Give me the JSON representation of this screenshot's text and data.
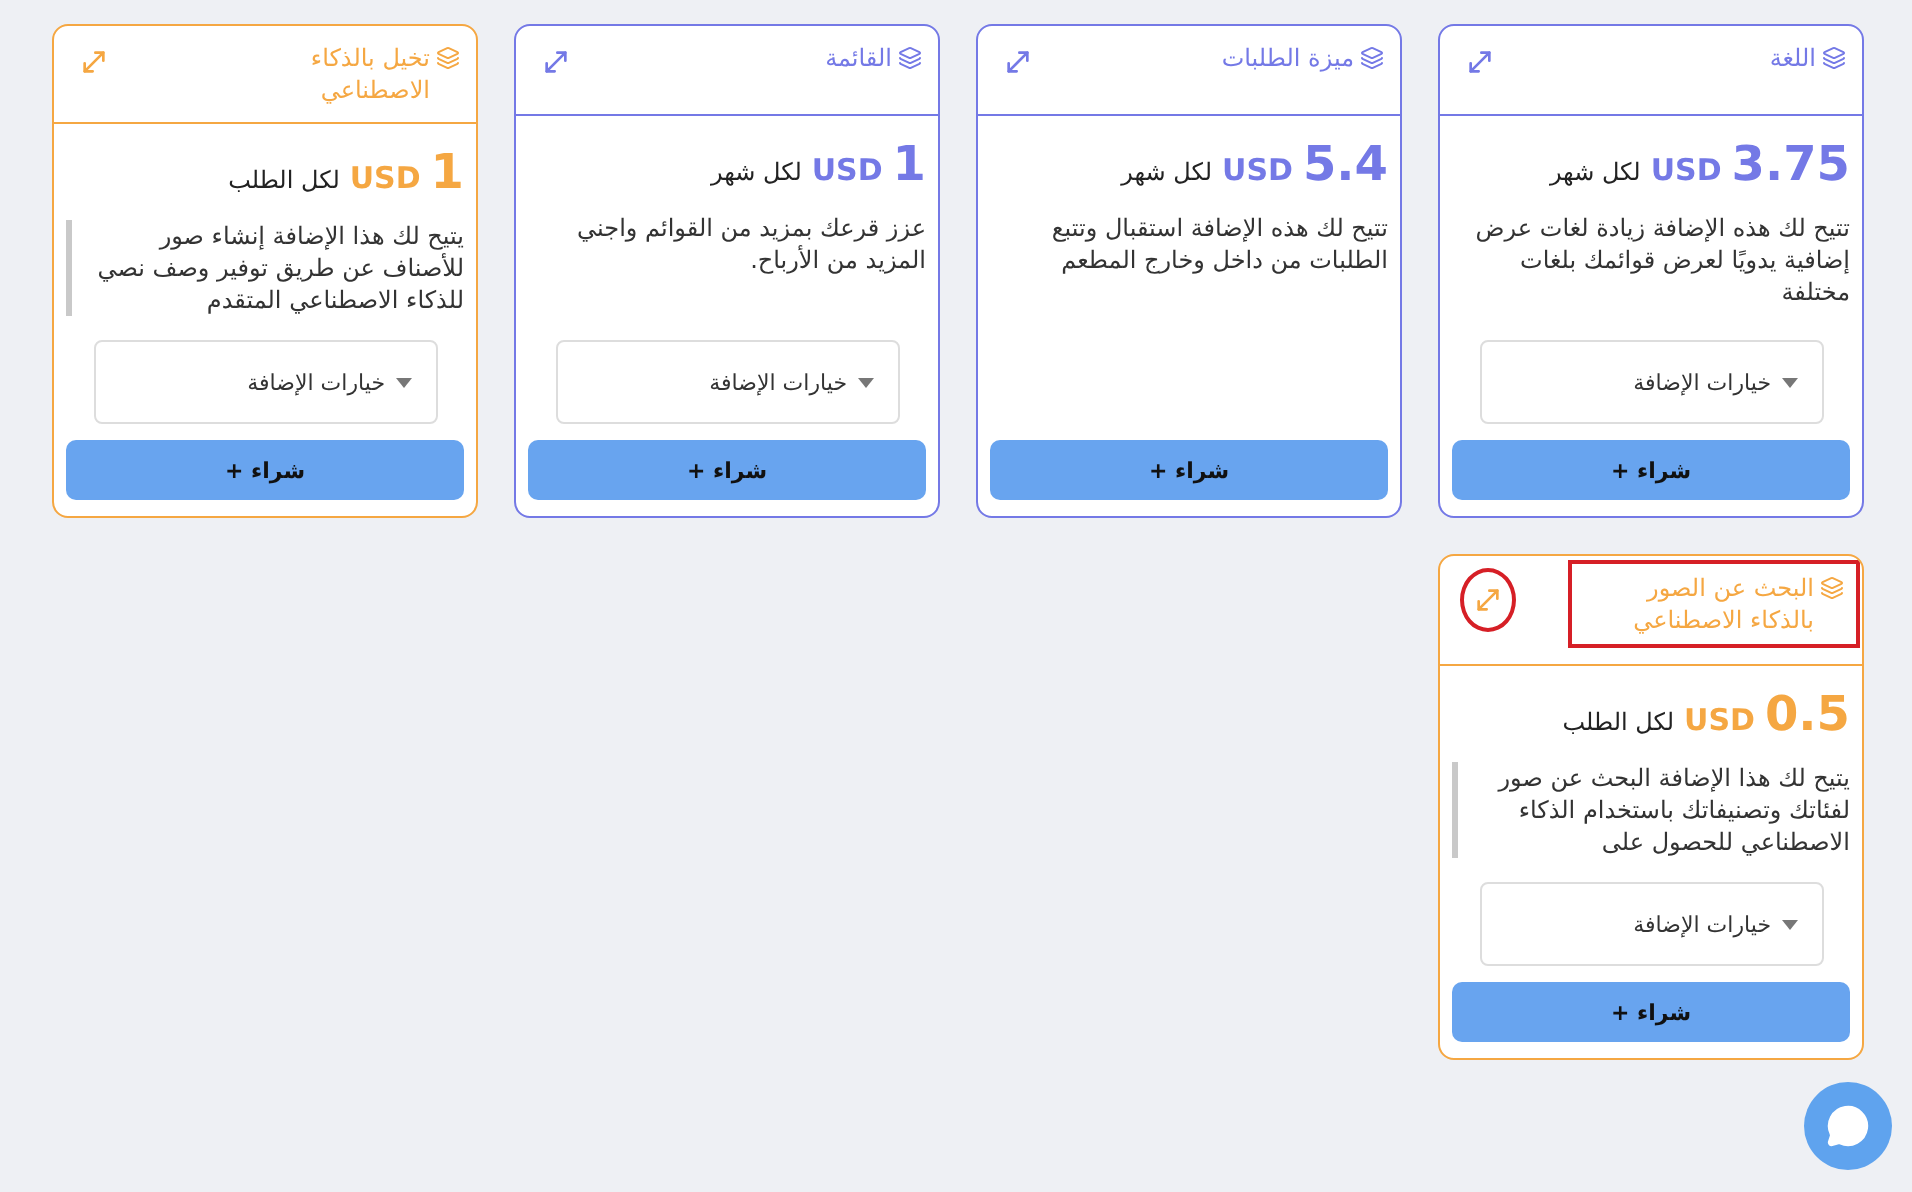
{
  "cards": [
    {
      "title": "اللغة",
      "color": "#7479e6",
      "annotated": false,
      "amount": "3.75",
      "currency": "USD",
      "period": "لكل شهر",
      "description": "تتيح لك هذه الإضافة زيادة لغات عرض إضافية يدويًا لعرض قوائمك بلغات مختلفة",
      "scrollable": false,
      "options": "خيارات الإضافة",
      "buy": "شراء +"
    },
    {
      "title": "ميزة الطلبات",
      "color": "#7479e6",
      "annotated": false,
      "amount": "5.4",
      "currency": "USD",
      "period": "لكل شهر",
      "description": "تتيح لك هذه الإضافة استقبال وتتبع الطلبات من داخل وخارج المطعم",
      "scrollable": false,
      "buy": "شراء +"
    },
    {
      "title": "القائمة",
      "color": "#7479e6",
      "annotated": false,
      "amount": "1",
      "currency": "USD",
      "period": "لكل شهر",
      "description": "عزز قرعك بمزيد من القوائم واجني المزيد من الأرباح.",
      "scrollable": false,
      "options": "خيارات الإضافة",
      "buy": "شراء +"
    },
    {
      "title": "تخيل بالذكاء الاصطناعي",
      "color": "#f5a742",
      "annotated": false,
      "amount": "1",
      "currency": "USD",
      "period": "لكل الطلب",
      "description": "يتيح لك هذا الإضافة إنشاء صور للأصناف عن طريق توفير وصف نصي للذكاء الاصطناعي المتقدم",
      "scrollable": true,
      "options": "خيارات الإضافة",
      "buy": "شراء +"
    },
    {
      "title": "البحث عن الصور بالذكاء الاصطناعي",
      "color": "#f5a742",
      "annotated": true,
      "amount": "0.5",
      "currency": "USD",
      "period": "لكل الطلب",
      "description": "يتيح لك هذا الإضافة البحث عن صور لفئاتك وتصنيفاتك باستخدام الذكاء الاصطناعي للحصول على",
      "scrollable": true,
      "options": "خيارات الإضافة",
      "buy": "شراء +"
    }
  ]
}
